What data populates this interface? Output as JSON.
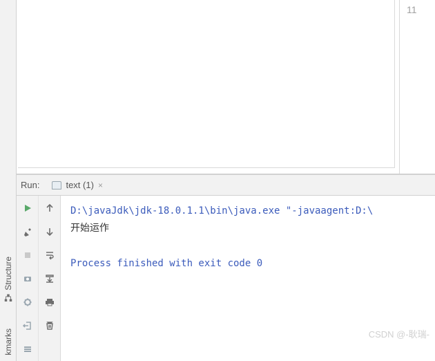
{
  "rail": {
    "structure": "Structure",
    "bookmarks": "kmarks"
  },
  "editor": {
    "line_number": "11"
  },
  "run": {
    "label": "Run:",
    "tab_name": "text (1)"
  },
  "console": {
    "command": "D:\\javaJdk\\jdk-18.0.1.1\\bin\\java.exe \"-javaagent:D:\\",
    "line2": "开始运作",
    "blank": "",
    "exit": "Process finished with exit code 0"
  },
  "watermark": "CSDN @-耿瑞-"
}
